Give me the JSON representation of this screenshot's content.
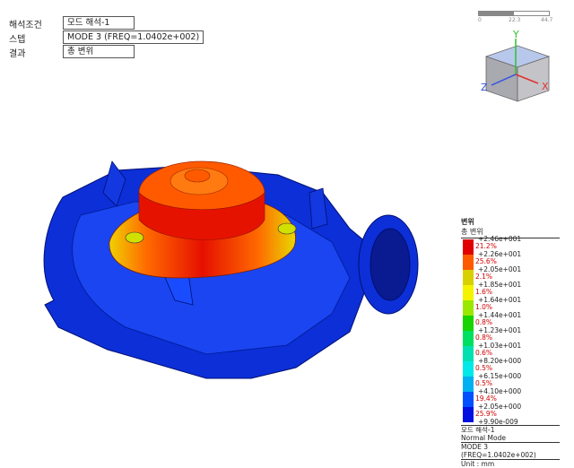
{
  "info": {
    "condition_label": "해석조건",
    "condition_value": "모드 해석-1",
    "step_label": "스텝",
    "step_value": "MODE 3 (FREQ=1.0402e+002)",
    "result_label": "결과",
    "result_value": "총 변위"
  },
  "scale_bar": {
    "ticks": [
      "0",
      "22.3",
      "44.7"
    ]
  },
  "view_cube": {
    "axis_y": "Y",
    "axis_x": "X",
    "axis_z": "Z",
    "icon": "view-cube-icon"
  },
  "legend": {
    "title": "변위",
    "subtitle": "총 변위",
    "values": [
      "+2.46e+001",
      "+2.26e+001",
      "+2.05e+001",
      "+1.85e+001",
      "+1.64e+001",
      "+1.44e+001",
      "+1.23e+001",
      "+1.03e+001",
      "+8.20e+000",
      "+6.15e+000",
      "+4.10e+000",
      "+2.05e+000",
      "+9.90e-009"
    ],
    "percents": [
      "21.2%",
      "25.6%",
      "2.1%",
      "1.6%",
      "1.0%",
      "0.8%",
      "0.8%",
      "0.6%",
      "0.5%",
      "0.5%",
      "19.4%",
      "25.9%"
    ],
    "colors": [
      "#e00000",
      "#ff5a00",
      "#d8d000",
      "#f4f400",
      "#9ae800",
      "#18d400",
      "#00e060",
      "#00e0b0",
      "#00e8e8",
      "#00b0f0",
      "#0050ff",
      "#0010e0"
    ],
    "footer_study": "모드 해석-1",
    "footer_mode": "Normal Mode",
    "footer_step": "MODE 3 (FREQ=1.0402e+002)",
    "footer_unit": "Unit : mm"
  }
}
